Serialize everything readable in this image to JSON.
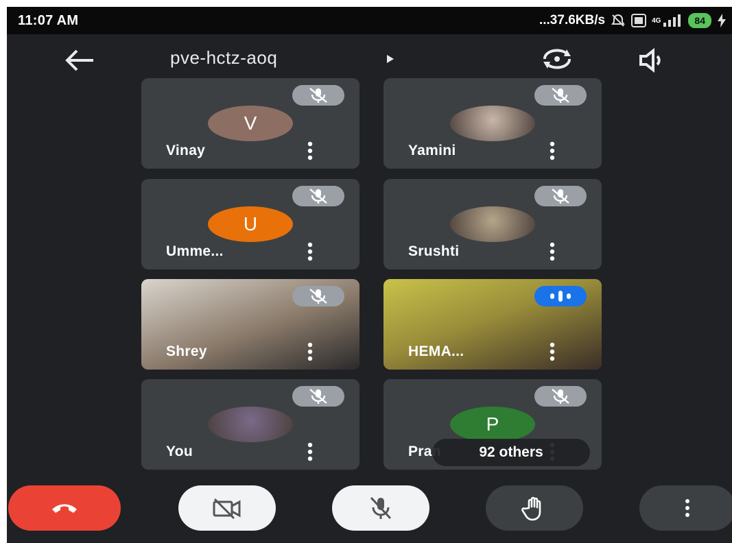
{
  "status_bar": {
    "time": "11:07 AM",
    "network_speed": "...37.6KB/s",
    "network_type": "4G",
    "battery": "84"
  },
  "header": {
    "meeting_code": "pve-hctz-aoq"
  },
  "participants": [
    {
      "name": "Vinay",
      "initial": "V",
      "avatar_color": "#8d6e63",
      "muted": true
    },
    {
      "name": "Yamini",
      "initial": "",
      "avatar_color": "#c9b6a8",
      "muted": true
    },
    {
      "name": "Umme...",
      "initial": "U",
      "avatar_color": "#e8710a",
      "muted": true
    },
    {
      "name": "Srushti",
      "initial": "",
      "avatar_color": "#b5a58a",
      "muted": true
    },
    {
      "name": "Shrey",
      "initial": "",
      "avatar_color": "#8a7a6a",
      "muted": true
    },
    {
      "name": "HEMA...",
      "initial": "",
      "avatar_color": "#bcae3a",
      "muted": false
    },
    {
      "name": "You",
      "initial": "",
      "avatar_color": "#7a6a8a",
      "muted": true
    },
    {
      "name": "Pran",
      "initial": "P",
      "avatar_color": "#2e7d32",
      "muted": true
    }
  ],
  "others": {
    "label": "92 others"
  },
  "colors": {
    "background": "#202124",
    "tile": "#3c4043",
    "hangup": "#ea4335",
    "speaking": "#1a73e8"
  }
}
